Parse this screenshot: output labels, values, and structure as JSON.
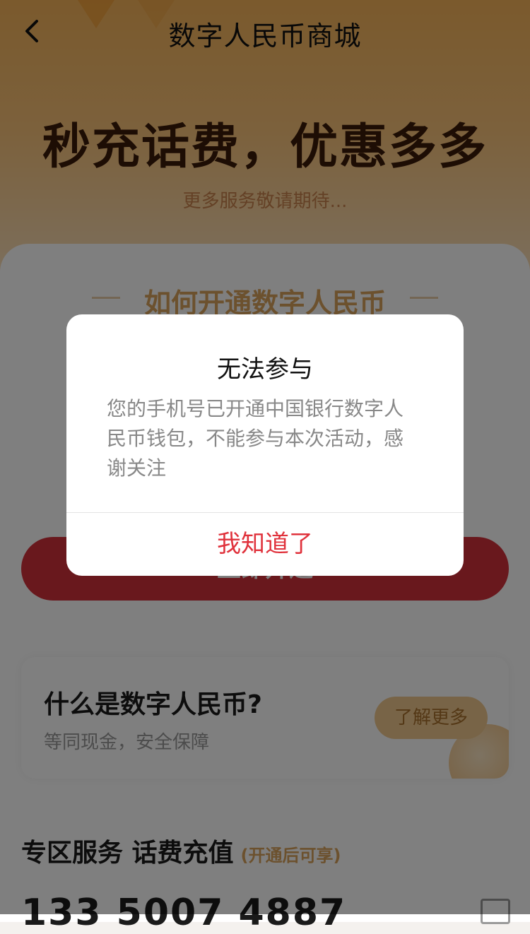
{
  "header": {
    "title": "数字人民币商城"
  },
  "hero": {
    "slogan": "秒充话费，优惠多多",
    "subtitle": "更多服务敬请期待..."
  },
  "section": {
    "how_title": "如何开通数字人民币",
    "cta_label": "立即开通"
  },
  "info_card": {
    "title": "什么是数字人民币?",
    "subtitle": "等同现金，安全保障",
    "learn_more": "了解更多"
  },
  "zone": {
    "title": "专区服务 话费充值",
    "note": "(开通后可享)"
  },
  "phone": {
    "number": "133 5007 4887"
  },
  "dialog": {
    "title": "无法参与",
    "message": "您的手机号已开通中国银行数字人民币钱包，不能参与本次活动，感谢关注",
    "confirm": "我知道了"
  },
  "colors": {
    "accent_red": "#e0323c",
    "hero_orange": "#f6b45a",
    "gold": "#d9a35c"
  }
}
